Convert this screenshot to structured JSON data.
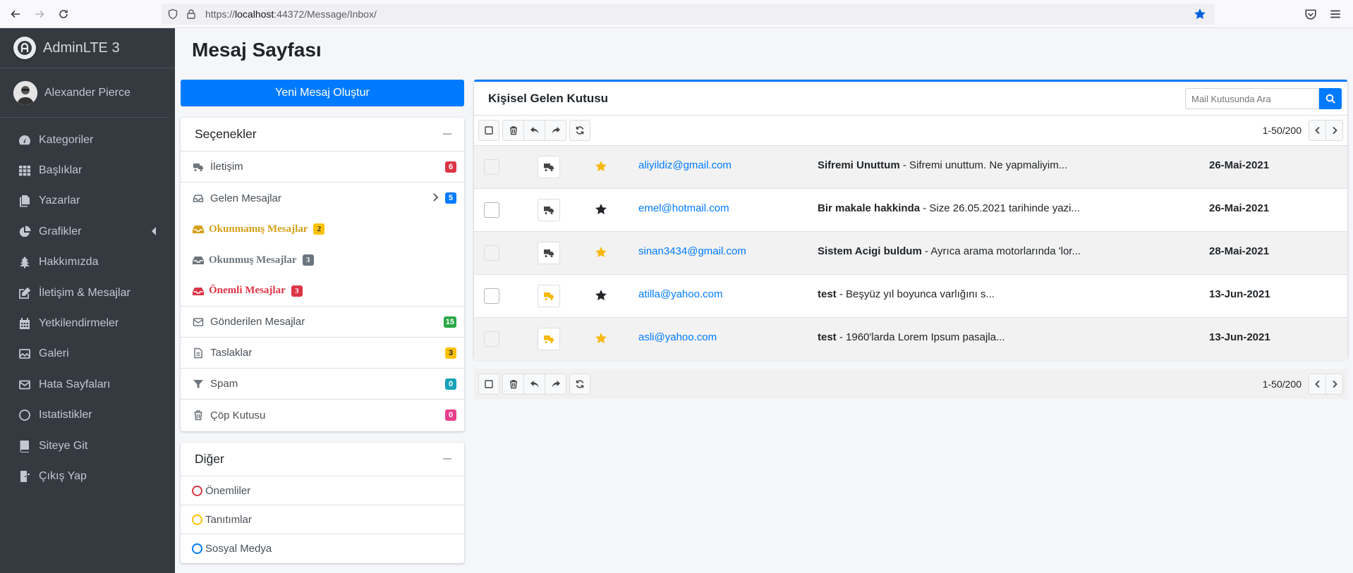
{
  "browser": {
    "url_prefix": "https://",
    "url_host": "localhost",
    "url_rest": ":44372/Message/Inbox/"
  },
  "sidebar": {
    "brand": "AdminLTE 3",
    "user": "Alexander Pierce",
    "items": [
      {
        "label": "Kategoriler",
        "icon": "tachometer-icon"
      },
      {
        "label": "Başlıklar",
        "icon": "grid-icon"
      },
      {
        "label": "Yazarlar",
        "icon": "copy-icon"
      },
      {
        "label": "Grafikler",
        "icon": "chart-pie-icon"
      },
      {
        "label": "Hakkımızda",
        "icon": "tree-icon"
      },
      {
        "label": "İletişim & Mesajlar",
        "icon": "edit-icon"
      },
      {
        "label": "Yetkilendirmeler",
        "icon": "calendar-icon"
      },
      {
        "label": "Galeri",
        "icon": "image-icon"
      },
      {
        "label": "Hata Sayfaları",
        "icon": "envelope-icon"
      },
      {
        "label": "Istatistikler",
        "icon": "circle-icon"
      },
      {
        "label": "Siteye Git",
        "icon": "book-icon"
      },
      {
        "label": "Çıkış Yap",
        "icon": "door-icon"
      }
    ]
  },
  "page": {
    "title": "Mesaj Sayfası",
    "compose": "Yeni Mesaj Oluştur"
  },
  "folders": {
    "title": "Seçenekler",
    "iletisim": {
      "label": "İletişim",
      "count": "6"
    },
    "gelen": {
      "label": "Gelen Mesajlar",
      "count": "5"
    },
    "okunmamis": {
      "label": "Okunmamış Mesajlar",
      "count": "2"
    },
    "okunmus": {
      "label": "Okunmuş Mesajlar",
      "count": "3"
    },
    "onemli": {
      "label": "Önemli Mesajlar",
      "count": "3"
    },
    "gonderilen": {
      "label": "Gönderilen Mesajlar",
      "count": "15"
    },
    "taslaklar": {
      "label": "Taslaklar",
      "count": "3"
    },
    "spam": {
      "label": "Spam",
      "count": "0"
    },
    "cop": {
      "label": "Çöp Kutusu",
      "count": "0"
    }
  },
  "labels": {
    "title": "Diğer",
    "items": [
      {
        "label": "Önemliler",
        "color": "#dc3545"
      },
      {
        "label": "Tanıtımlar",
        "color": "#ffc107"
      },
      {
        "label": "Sosyal Medya",
        "color": "#007bff"
      }
    ]
  },
  "inbox": {
    "title": "Kişisel Gelen Kutusu",
    "search_placeholder": "Mail Kutusunda Ara",
    "pager": "1-50/200",
    "rows": [
      {
        "sender": "aliyildiz@gmail.com",
        "subject": "Sifremi Unuttum",
        "snippet": " - Sifremi unuttum. Ne yapmaliyim...",
        "date": "26-Mai-2021",
        "starred": true,
        "read": true
      },
      {
        "sender": "emel@hotmail.com",
        "subject": "Bir makale hakkinda",
        "snippet": " - Size 26.05.2021 tarihinde yazi...",
        "date": "26-Mai-2021",
        "starred": false,
        "read": true
      },
      {
        "sender": "sinan3434@gmail.com",
        "subject": "Sistem Acigi buldum",
        "snippet": " - Ayrıca arama motorlarında 'lor...",
        "date": "28-Mai-2021",
        "starred": true,
        "read": true
      },
      {
        "sender": "atilla@yahoo.com",
        "subject": "test",
        "snippet": " - Beşyüz yıl boyunca varlığını s...",
        "date": "13-Jun-2021",
        "starred": false,
        "read": false
      },
      {
        "sender": "asli@yahoo.com",
        "subject": "test",
        "snippet": " - 1960'larda Lorem Ipsum pasajla...",
        "date": "13-Jun-2021",
        "starred": true,
        "read": false
      }
    ]
  },
  "colors": {
    "primary": "#007bff",
    "danger": "#dc3545",
    "warning": "#ffc107",
    "success": "#28a745",
    "info": "#17a2b8",
    "secondary": "#6c757d",
    "pink": "#e83e8c",
    "gold": "#d4a017",
    "star_yellow": "#f5b90c"
  }
}
